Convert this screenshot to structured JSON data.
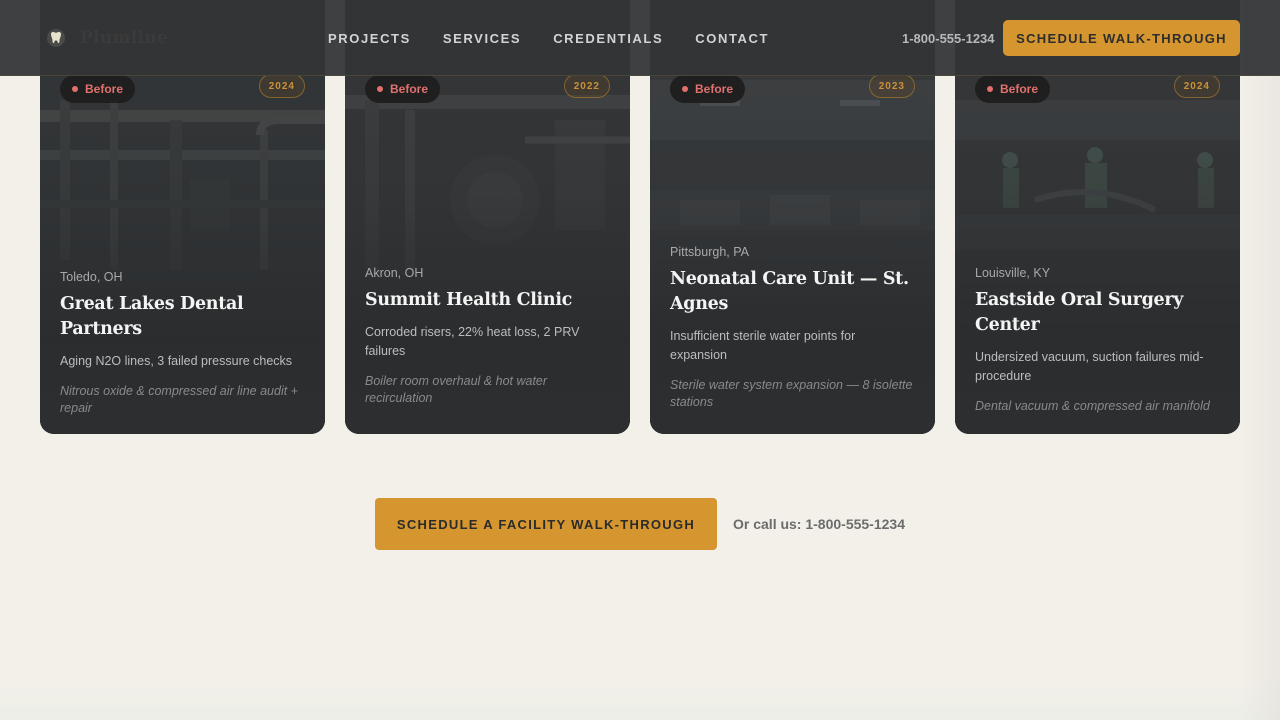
{
  "header": {
    "brand": "Plumline",
    "nav": [
      "PROJECTS",
      "SERVICES",
      "CREDENTIALS",
      "CONTACT"
    ],
    "phone": "1-800-555-1234",
    "cta_label": "SCHEDULE WALK-THROUGH"
  },
  "cards": [
    {
      "badge": "Before",
      "year": "2024",
      "location": "Toledo, OH",
      "title": "Great Lakes Dental Partners",
      "problem": "Aging N2O lines, 3 failed pressure checks",
      "scope": "Nitrous oxide & compressed air line audit + repair"
    },
    {
      "badge": "Before",
      "year": "2022",
      "location": "Akron, OH",
      "title": "Summit Health Clinic",
      "problem": "Corroded risers, 22% heat loss, 2 PRV failures",
      "scope": "Boiler room overhaul & hot water recirculation"
    },
    {
      "badge": "Before",
      "year": "2023",
      "location": "Pittsburgh, PA",
      "title": "Neonatal Care Unit — St. Agnes",
      "problem": "Insufficient sterile water points for expansion",
      "scope": "Sterile water system expansion — 8 isolette stations"
    },
    {
      "badge": "Before",
      "year": "2024",
      "location": "Louisville, KY",
      "title": "Eastside Oral Surgery Center",
      "problem": "Undersized vacuum, suction failures mid-procedure",
      "scope": "Dental vacuum & compressed air manifold"
    }
  ],
  "cta": {
    "label": "SCHEDULE A FACILITY WALK-THROUGH",
    "call_text": "Or call us: 1-800-555-1234"
  },
  "colors": {
    "accent": "#d6962f",
    "before_badge": "#e0716d",
    "card_bg": "#2c2e30",
    "page_bg": "#f3f0e9"
  },
  "icons": {
    "logo": "tooth-logo-icon",
    "before_dot": "status-dot-icon"
  }
}
